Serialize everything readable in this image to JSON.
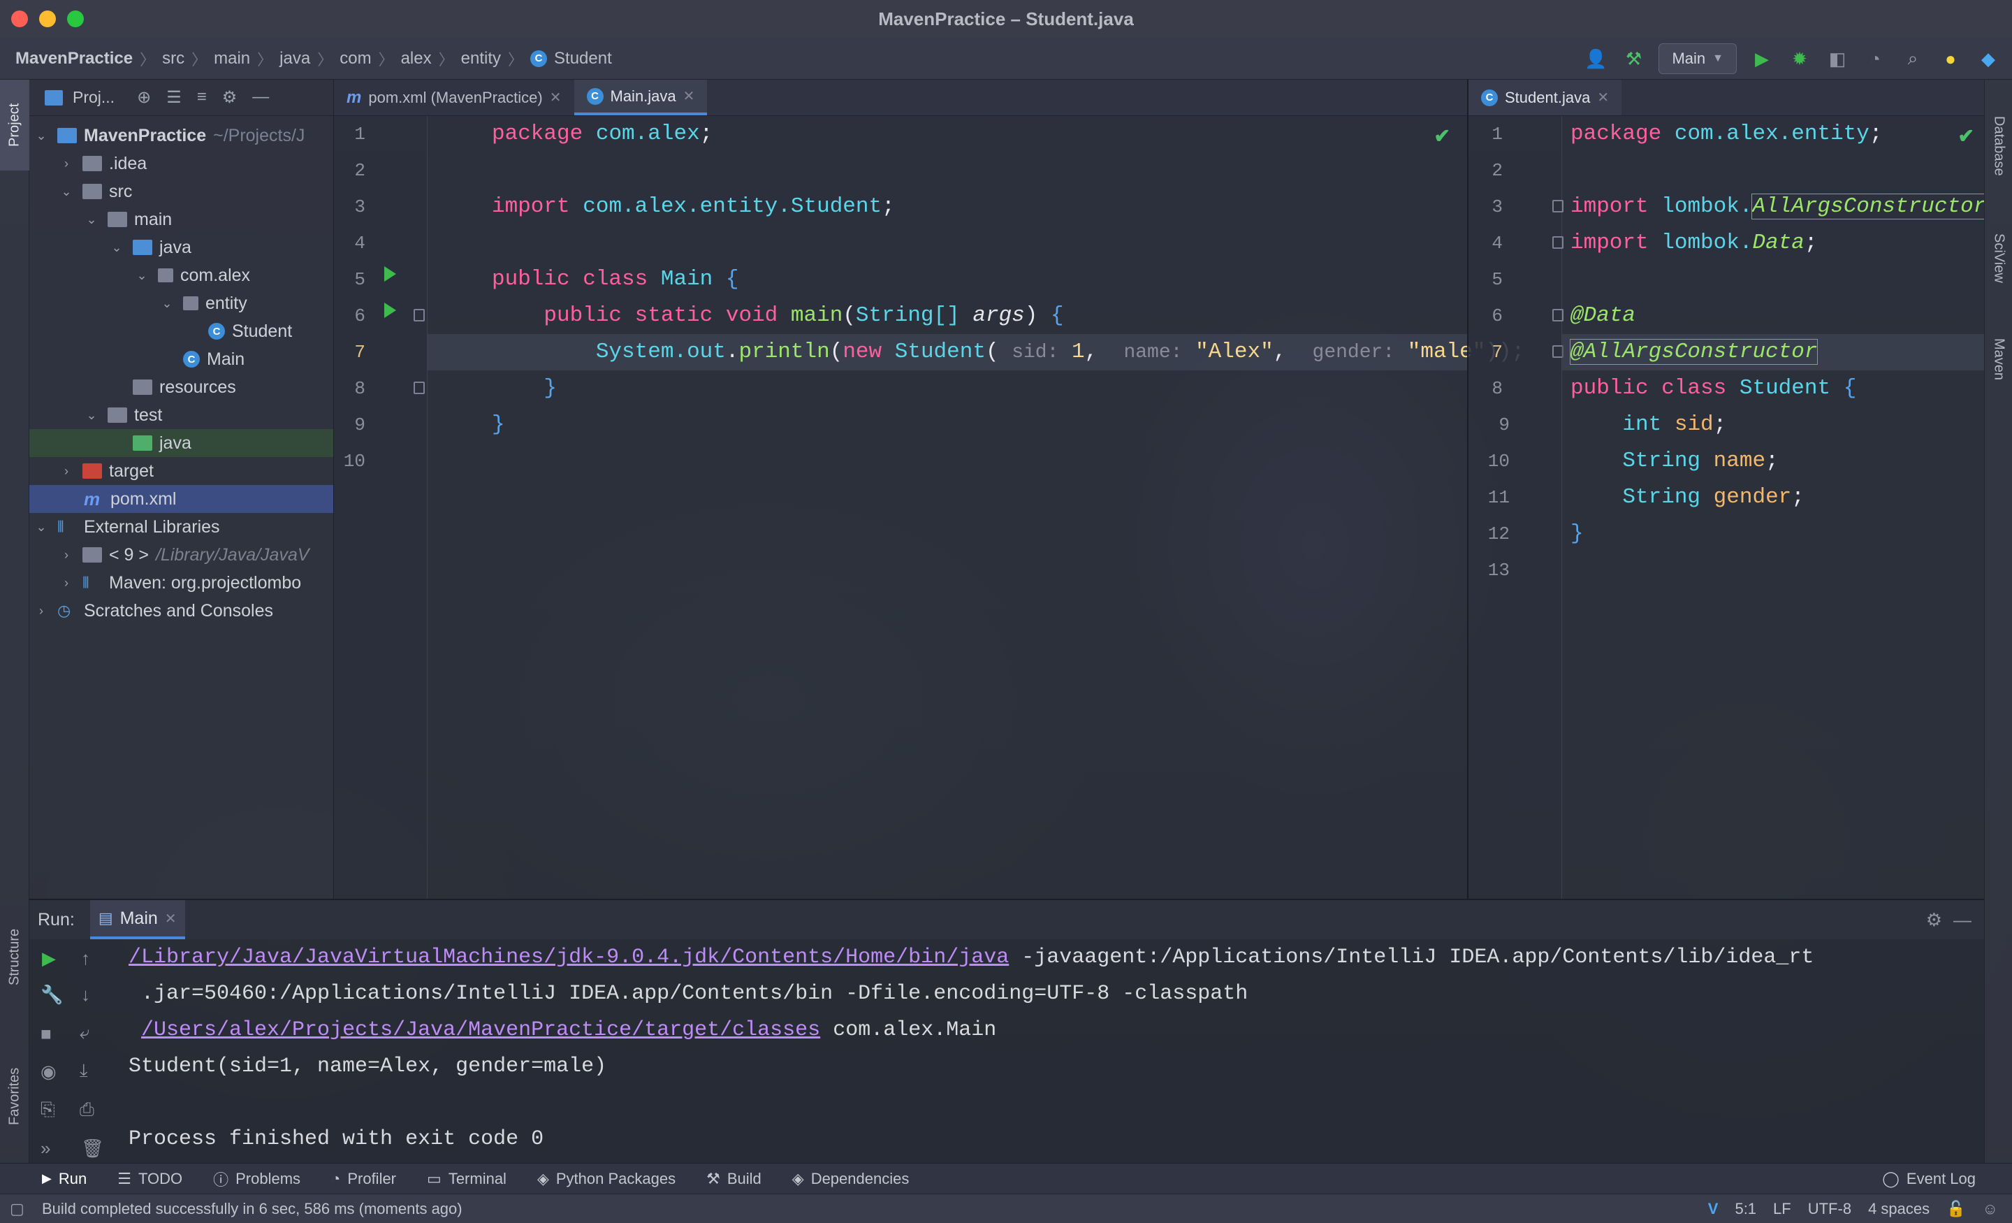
{
  "window": {
    "title": "MavenPractice – Student.java"
  },
  "breadcrumb": [
    "MavenPractice",
    "src",
    "main",
    "java",
    "com",
    "alex",
    "entity",
    "Student"
  ],
  "toolbar": {
    "run_config": "Main"
  },
  "left_strip": {
    "project_tab": "Project",
    "structure_tab": "Structure",
    "favorites_tab": "Favorites"
  },
  "right_strip": {
    "database_tab": "Database",
    "sciview_tab": "SciView",
    "maven_tab": "Maven"
  },
  "project": {
    "header": "Proj...",
    "tree": [
      {
        "label": "MavenPractice",
        "extra": "~/Projects/J"
      },
      {
        "label": ".idea",
        "extra": ""
      },
      {
        "label": "src",
        "extra": ""
      },
      {
        "label": "main",
        "extra": ""
      },
      {
        "label": "java",
        "extra": ""
      },
      {
        "label": "com.alex",
        "extra": ""
      },
      {
        "label": "entity",
        "extra": ""
      },
      {
        "label": "Student",
        "extra": ""
      },
      {
        "label": "Main",
        "extra": ""
      },
      {
        "label": "resources",
        "extra": ""
      },
      {
        "label": "test",
        "extra": ""
      },
      {
        "label": "java",
        "extra": ""
      },
      {
        "label": "target",
        "extra": ""
      },
      {
        "label": "pom.xml",
        "extra": ""
      },
      {
        "label": "External Libraries",
        "extra": ""
      },
      {
        "label": "< 9 >",
        "extra": "/Library/Java/JavaV"
      },
      {
        "label": "Maven: org.projectlombo",
        "extra": ""
      },
      {
        "label": "Scratches and Consoles",
        "extra": ""
      }
    ]
  },
  "editor_left": {
    "tabs": [
      {
        "label": "pom.xml (MavenPractice)"
      },
      {
        "label": "Main.java"
      }
    ],
    "line_numbers": [
      "1",
      "2",
      "3",
      "4",
      "5",
      "6",
      "7",
      "8",
      "9",
      "10"
    ],
    "code": {
      "l1_kw": "package",
      "l1_pkg": "com.alex",
      "l3_kw": "import",
      "l3_pkg": "com.alex.entity.Student",
      "l5_kw": "public class",
      "l5_name": "Main",
      "l6_kw": "public static void",
      "l6_fn": "main",
      "l6_type": "String[]",
      "l6_arg": "args",
      "l7_sys": "System.",
      "l7_out": "out",
      "l7_fn": "println",
      "l7_new": "new",
      "l7_cls": "Student",
      "l7_h1": "sid:",
      "l7_v1": "1",
      "l7_h2": "name:",
      "l7_v2": "\"Alex\"",
      "l7_h3": "gender:",
      "l7_v3": "\"male\""
    }
  },
  "editor_right": {
    "tabs": [
      {
        "label": "Student.java"
      }
    ],
    "line_numbers": [
      "1",
      "2",
      "3",
      "4",
      "5",
      "6",
      "7",
      "8",
      "9",
      "10",
      "11",
      "12",
      "13"
    ],
    "code": {
      "l1_kw": "package",
      "l1_pkg": "com.alex.entity",
      "l3_kw": "import",
      "l3_pkg": "lombok.",
      "l3_ann": "AllArgsConstructor",
      "l4_kw": "import",
      "l4_pkg": "lombok.",
      "l4_ann": "Data",
      "l6_ann": "@Data",
      "l7_ann": "@AllArgsConstructor",
      "l8_kw": "public class",
      "l8_name": "Student",
      "l9_type": "int",
      "l9_field": "sid",
      "l10_type": "String",
      "l10_field": "name",
      "l11_type": "String",
      "l11_field": "gender"
    }
  },
  "run": {
    "label": "Run:",
    "tab": "Main",
    "console": {
      "java_path": "/Library/Java/JavaVirtualMachines/jdk-9.0.4.jdk/Contents/Home/bin/java",
      "line1_rest": " -javaagent:/Applications/IntelliJ IDEA.app/Contents/lib/idea_rt",
      "line2": " .jar=50460:/Applications/IntelliJ IDEA.app/Contents/bin -Dfile.encoding=UTF-8 -classpath",
      "classes_path": "/Users/alex/Projects/Java/MavenPractice/target/classes",
      "line3_rest": " com.alex.Main",
      "output": "Student(sid=1, name=Alex, gender=male)",
      "exit": "Process finished with exit code 0"
    }
  },
  "toolwindows": {
    "items": [
      "Run",
      "TODO",
      "Problems",
      "Profiler",
      "Terminal",
      "Python Packages",
      "Build",
      "Dependencies"
    ],
    "event_log": "Event Log"
  },
  "status": {
    "message": "Build completed successfully in 6 sec, 586 ms (moments ago)",
    "position": "5:1",
    "line_sep": "LF",
    "encoding": "UTF-8",
    "indent": "4 spaces"
  },
  "colors": {
    "keyword": "#ff5f9f",
    "type": "#5ad6e8",
    "function": "#9ce56a",
    "string": "#f6d78b",
    "link": "#bd8cf5",
    "accent": "#4a88dd"
  }
}
